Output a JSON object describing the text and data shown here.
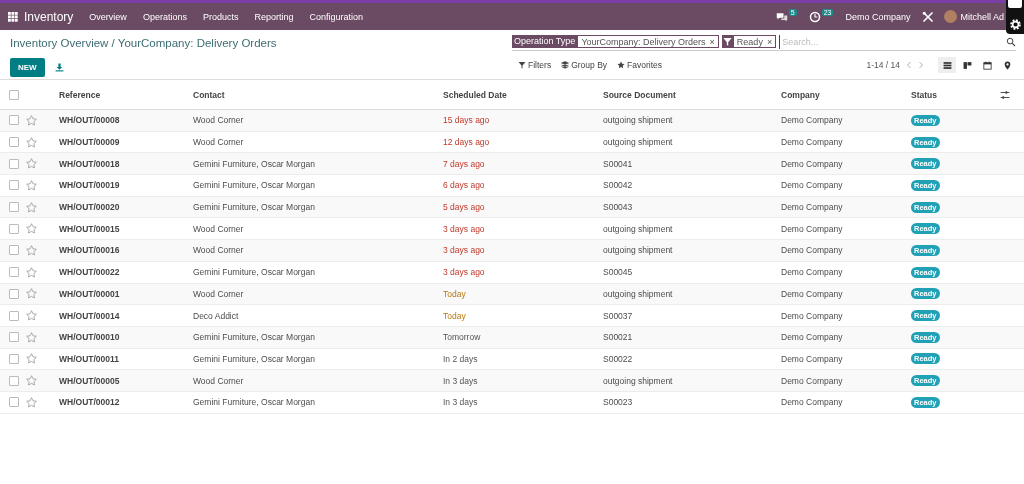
{
  "navbar": {
    "app": "Inventory",
    "menu": [
      "Overview",
      "Operations",
      "Products",
      "Reporting",
      "Configuration"
    ],
    "messages_badge": "5",
    "activities_badge": "23",
    "company": "Demo Company",
    "user": "Mitchell Ad"
  },
  "breadcrumb": "Inventory Overview / YourCompany: Delivery Orders",
  "new_button": "NEW",
  "search": {
    "facets": [
      {
        "kind": "field",
        "label": "Operation Type",
        "value": "YourCompany: Delivery Orders",
        "remove": "×"
      },
      {
        "kind": "filter",
        "value": "Ready",
        "remove": "×"
      }
    ],
    "placeholder": "Search..."
  },
  "toolbar": {
    "filters": "Filters",
    "group_by": "Group By",
    "favorites": "Favorites"
  },
  "pager": "1-14 / 14",
  "views": [
    {
      "kind": "list",
      "selected": true
    },
    {
      "kind": "kanban",
      "selected": false
    },
    {
      "kind": "calendar",
      "selected": false
    },
    {
      "kind": "map",
      "selected": false
    }
  ],
  "table": {
    "select_all_checked": false,
    "columns": [
      "Reference",
      "Contact",
      "Scheduled Date",
      "Source Document",
      "Company",
      "Status"
    ],
    "rows": [
      {
        "checked": false,
        "starred": false,
        "reference": "WH/OUT/00008",
        "contact": "Wood Corner",
        "scheduled_date": "15 days ago",
        "overdue": true,
        "due_today": false,
        "source_document": "outgoing shipment",
        "company": "Demo Company",
        "status": "Ready"
      },
      {
        "checked": false,
        "starred": false,
        "reference": "WH/OUT/00009",
        "contact": "Wood Corner",
        "scheduled_date": "12 days ago",
        "overdue": true,
        "due_today": false,
        "source_document": "outgoing shipment",
        "company": "Demo Company",
        "status": "Ready"
      },
      {
        "checked": false,
        "starred": false,
        "reference": "WH/OUT/00018",
        "contact": "Gemini Furniture, Oscar Morgan",
        "scheduled_date": "7 days ago",
        "overdue": true,
        "due_today": false,
        "source_document": "S00041",
        "company": "Demo Company",
        "status": "Ready"
      },
      {
        "checked": false,
        "starred": false,
        "reference": "WH/OUT/00019",
        "contact": "Gemini Furniture, Oscar Morgan",
        "scheduled_date": "6 days ago",
        "overdue": true,
        "due_today": false,
        "source_document": "S00042",
        "company": "Demo Company",
        "status": "Ready"
      },
      {
        "checked": false,
        "starred": false,
        "reference": "WH/OUT/00020",
        "contact": "Gemini Furniture, Oscar Morgan",
        "scheduled_date": "5 days ago",
        "overdue": true,
        "due_today": false,
        "source_document": "S00043",
        "company": "Demo Company",
        "status": "Ready"
      },
      {
        "checked": false,
        "starred": false,
        "reference": "WH/OUT/00015",
        "contact": "Wood Corner",
        "scheduled_date": "3 days ago",
        "overdue": true,
        "due_today": false,
        "source_document": "outgoing shipment",
        "company": "Demo Company",
        "status": "Ready"
      },
      {
        "checked": false,
        "starred": false,
        "reference": "WH/OUT/00016",
        "contact": "Wood Corner",
        "scheduled_date": "3 days ago",
        "overdue": true,
        "due_today": false,
        "source_document": "outgoing shipment",
        "company": "Demo Company",
        "status": "Ready"
      },
      {
        "checked": false,
        "starred": false,
        "reference": "WH/OUT/00022",
        "contact": "Gemini Furniture, Oscar Morgan",
        "scheduled_date": "3 days ago",
        "overdue": true,
        "due_today": false,
        "source_document": "S00045",
        "company": "Demo Company",
        "status": "Ready"
      },
      {
        "checked": false,
        "starred": false,
        "reference": "WH/OUT/00001",
        "contact": "Wood Corner",
        "scheduled_date": "Today",
        "overdue": false,
        "due_today": true,
        "source_document": "outgoing shipment",
        "company": "Demo Company",
        "status": "Ready"
      },
      {
        "checked": false,
        "starred": false,
        "reference": "WH/OUT/00014",
        "contact": "Deco Addict",
        "scheduled_date": "Today",
        "overdue": false,
        "due_today": true,
        "source_document": "S00037",
        "company": "Demo Company",
        "status": "Ready"
      },
      {
        "checked": false,
        "starred": false,
        "reference": "WH/OUT/00010",
        "contact": "Gemini Furniture, Oscar Morgan",
        "scheduled_date": "Tomorrow",
        "overdue": false,
        "due_today": false,
        "source_document": "S00021",
        "company": "Demo Company",
        "status": "Ready"
      },
      {
        "checked": false,
        "starred": false,
        "reference": "WH/OUT/00011",
        "contact": "Gemini Furniture, Oscar Morgan",
        "scheduled_date": "In 2 days",
        "overdue": false,
        "due_today": false,
        "source_document": "S00022",
        "company": "Demo Company",
        "status": "Ready"
      },
      {
        "checked": false,
        "starred": false,
        "reference": "WH/OUT/00005",
        "contact": "Wood Corner",
        "scheduled_date": "In 3 days",
        "overdue": false,
        "due_today": false,
        "source_document": "outgoing shipment",
        "company": "Demo Company",
        "status": "Ready"
      },
      {
        "checked": false,
        "starred": false,
        "reference": "WH/OUT/00012",
        "contact": "Gemini Furniture, Oscar Morgan",
        "scheduled_date": "In 3 days",
        "overdue": false,
        "due_today": false,
        "source_document": "S00023",
        "company": "Demo Company",
        "status": "Ready"
      }
    ]
  }
}
